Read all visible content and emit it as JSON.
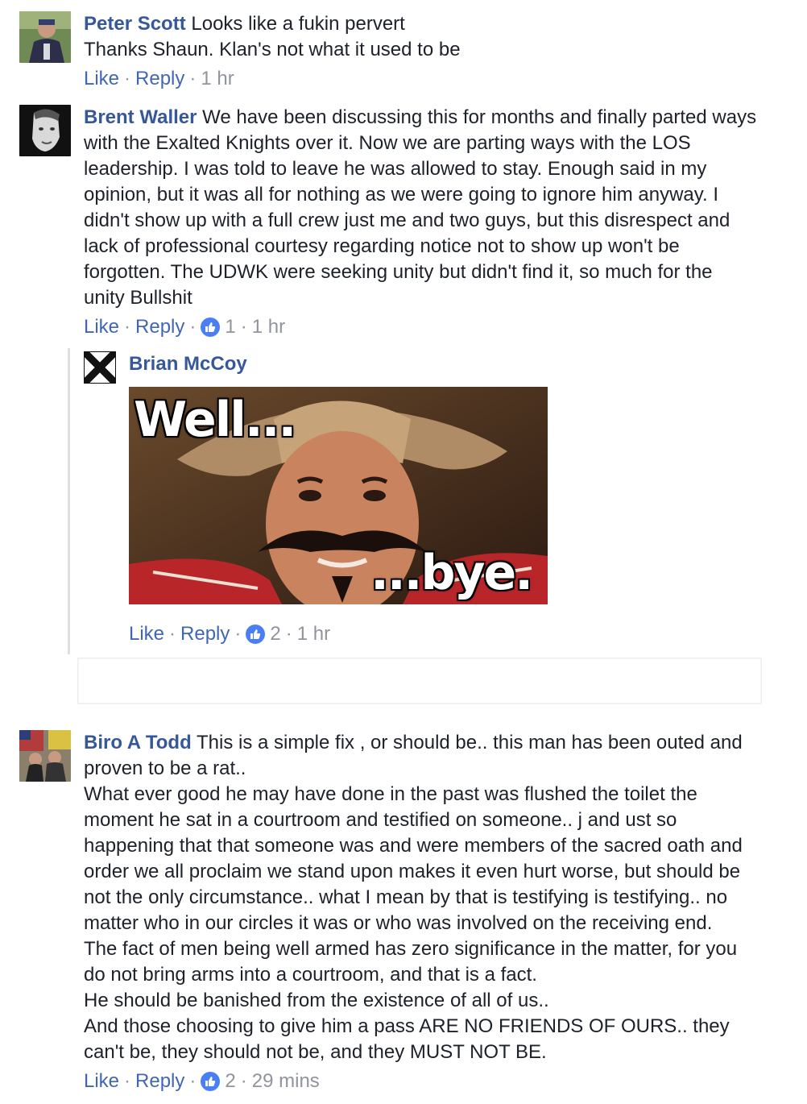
{
  "comments": [
    {
      "author": "Peter Scott",
      "lines": [
        " Looks like a fukin pervert",
        "Thanks Shaun. Klan's not what it used to be"
      ],
      "actions": {
        "like": "Like",
        "reply": "Reply",
        "time": "1 hr"
      }
    },
    {
      "author": "Brent Waller",
      "lines": [
        " We have been discussing this for months and finally parted ways",
        "with the Exalted Knights over it. Now we are parting ways with the LOS",
        "leadership. I was told to leave he was allowed to stay. Enough said in my",
        "opinion, but it was all for nothing as we were going to ignore him anyway. I",
        "didn't show up with a full crew just me and two guys, but this disrespect and",
        "lack of professional courtesy regarding notice not to show up won't be",
        "forgotten. The UDWK were seeking unity but didn't find it, so much for the",
        "unity Bullshit"
      ],
      "actions": {
        "like": "Like",
        "reply": "Reply",
        "reactions": "1",
        "time": "1 hr"
      }
    },
    {
      "author": "Biro A Todd",
      "lines": [
        " This is a simple fix , or should be.. this man has been outed and",
        "proven to be a rat..",
        "What ever good he may have done in the past was flushed the toilet the",
        "moment he sat in a courtroom and testified on someone.. j and ust so",
        "happening that that someone was and were members of the sacred oath and",
        "order we all proclaim we stand upon makes it even hurt worse, but should be",
        "not the only circumstance.. what I mean by that is testifying is testifying.. no",
        "matter who in our circles it was or who was involved on the receiving end.",
        "The fact of men being well armed has zero significance in the matter, for you",
        "do not bring arms into a courtroom, and that is a fact.",
        "He should be banished from the existence of all of us..",
        "And those choosing to give him a pass ARE NO FRIENDS OF OURS.. they",
        "can't be, they should not be, and they MUST NOT BE."
      ],
      "actions": {
        "like": "Like",
        "reply": "Reply",
        "reactions": "2",
        "time": "29 mins"
      }
    }
  ],
  "reply": {
    "author": "Brian McCoy",
    "meme_top": "Well...",
    "meme_bottom": "...bye.",
    "actions": {
      "like": "Like",
      "reply": "Reply",
      "reactions": "2",
      "time": "1 hr"
    }
  },
  "separator": "·",
  "colors": {
    "link": "#365899",
    "action_link": "#4267b2",
    "meta": "#90949c",
    "like_badge": "#4a7ef4"
  }
}
